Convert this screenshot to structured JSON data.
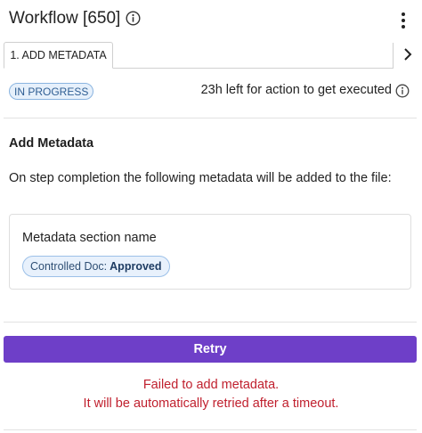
{
  "header": {
    "title": "Workflow [650]",
    "info_icon": "info-circle-icon",
    "menu_icon": "more-vertical-icon"
  },
  "tabs": [
    {
      "label": "1. ADD METADATA",
      "active": true
    }
  ],
  "tab_nav_icon": "chevron-right-icon",
  "status": {
    "badge": "IN PROGRESS",
    "time_left": "23h left for action to get executed",
    "info_icon": "info-circle-icon"
  },
  "section": {
    "title": "Add Metadata",
    "description": "On step completion the following metadata will be added to the file:"
  },
  "metadata_card": {
    "title": "Metadata section name",
    "chip_key": "Controlled Doc:",
    "chip_value": "Approved"
  },
  "actions": {
    "retry_label": "Retry"
  },
  "error": {
    "line1": "Failed to add metadata.",
    "line2": "It will be automatically retried after a timeout."
  },
  "colors": {
    "accent": "#6e3fc8",
    "error": "#c0202e",
    "badge_bg": "#e6f0fb",
    "badge_border": "#8ab4e0"
  }
}
